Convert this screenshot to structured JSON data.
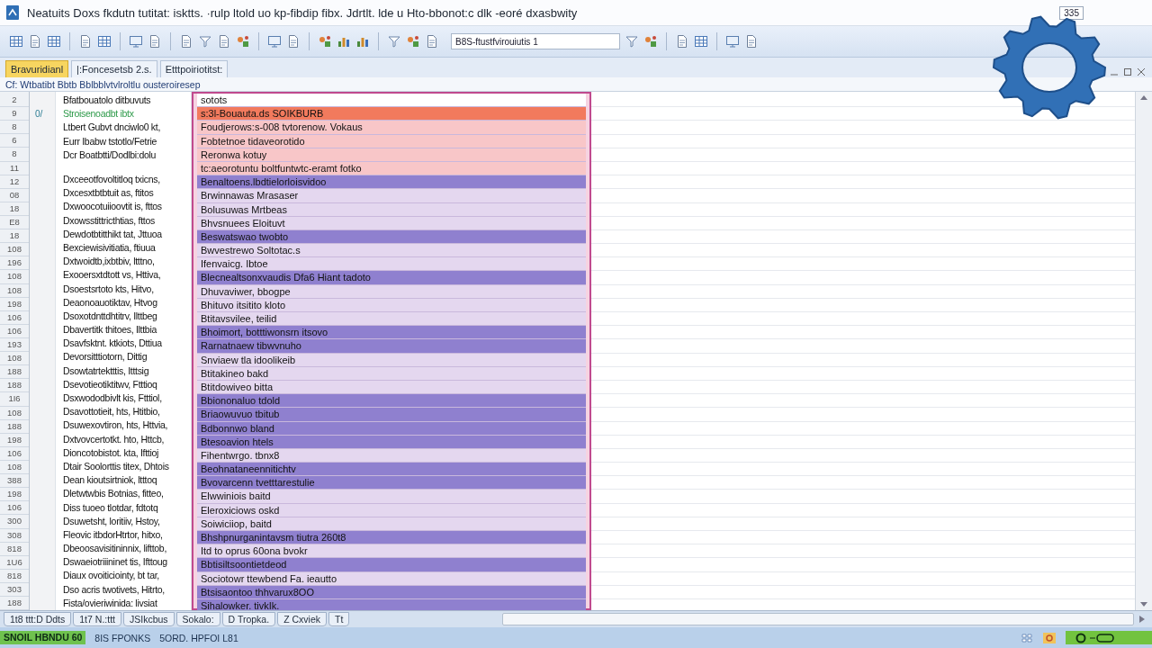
{
  "window": {
    "title": "Neatuits Doxs fkdutn tutitat: isktts. ·rulp ltold uo kp-fibdip fibx. Jdrtlt. lde u Hto-bbonot:c dlk -eoré dxasbwity",
    "badge": "335"
  },
  "toolbar": {
    "field_value": "B8S-ftustfvirouiutis 1"
  },
  "tabs": [
    {
      "label": "Bravuridianl",
      "selected": true
    },
    {
      "label": "|:Foncesetsb 2.s.",
      "selected": false
    },
    {
      "label": "Etttpoiriotitst:",
      "selected": false
    }
  ],
  "formula_bar": {
    "text": "Cf: Wtbatibt Bbtb Bblbblvtvlroltlu ousteroiresep"
  },
  "rows": [
    {
      "number": "2",
      "left": "Bfatbouatolo ditbuvuts",
      "right": "sotots",
      "kind": "plain"
    },
    {
      "number": "9",
      "marker": "0/",
      "left": "Stroisenoadbt ibtx",
      "color": "#2e9a4a",
      "right": "s:3l-Bouauta.ds SOIKBURB",
      "kind": "accent"
    },
    {
      "number": "8",
      "left": "Ltbert Gubvt dnciwlo0 kt,",
      "right": "Foudjerows:s-008 tvtorenow. Vokaus",
      "kind": "pink"
    },
    {
      "number": "6",
      "left": "Eurr Ibabw tstotlo/Fetrie",
      "right": "Fobtetnoe tidaveorotido",
      "kind": "pink"
    },
    {
      "number": "8",
      "left": "Dcr Boatbtti/Dodlbi:dolu",
      "right": "Reronwa kotuy",
      "kind": "pink"
    },
    {
      "number": "11",
      "right": "tc:aeorotuntu boltfuntwtc-eramt fotko",
      "kind": "pink"
    },
    {
      "number": "12",
      "left": "Dxceeotfovoltitloq txicns,",
      "right": "Benaltoens.lbdtielorloisvidoo",
      "kind": "strong"
    },
    {
      "number": "08",
      "left": "Dxcesxtbtbtuit as, ftitos",
      "right": "Brwinnawas Mrasaser",
      "kind": "pale"
    },
    {
      "number": "18",
      "left": "Dxwoocotuiioovtit is, fttos",
      "right": "Bolusuwas Mrtbeas",
      "kind": "pale"
    },
    {
      "number": "E8",
      "left": "Dxowsstittricthtias, fttos",
      "right": "Bhvsnuees Eloituvt",
      "kind": "pale"
    },
    {
      "number": "18",
      "left": "Dewdotbtitthikt tat, Jttuoa",
      "right": "Beswatswao twobto",
      "kind": "strong"
    },
    {
      "number": "108",
      "left": "Bexciewisivitiatia, ftiuua",
      "right": "Bwvestrewo Soltotac.s",
      "kind": "pale"
    },
    {
      "number": "196",
      "left": "Dxtwoidtb,ixbtbiv, ltttno,",
      "right": "Ifenvaicg. Ibtoe",
      "kind": "pale"
    },
    {
      "number": "108",
      "left": "Exooersxtdtott vs, Httiva,",
      "right": "Blecnealtsonxvaudis Dfa6 Hiant tadoto",
      "kind": "strong"
    },
    {
      "number": "108",
      "left": "Dsoestsrtoto kts, Hitvo,",
      "right": "Dhuvaviwer, bbogpe",
      "kind": "pale"
    },
    {
      "number": "198",
      "left": "Deaonoauotiktav, Htvog",
      "right": "Bhituvo itsitito kloto",
      "kind": "pale"
    },
    {
      "number": "106",
      "left": "Dsoxotdnttdhtitrv, Ilttbeg",
      "right": "Btitavsvilee, teilid",
      "kind": "pale"
    },
    {
      "number": "106",
      "left": "Dbavertitk thitoes, Ilttbia",
      "right": "Bhoimort, botttiwonsrn itsovo",
      "kind": "strong"
    },
    {
      "number": "193",
      "left": "Dsavfsktnt. ktkiots, Dttiua",
      "right": "Rarnatnaew tibwvnuho",
      "kind": "strong"
    },
    {
      "number": "108",
      "left": "Devorsitttiotorn, Dittig",
      "right": "Snviaew tla idoolikeib",
      "kind": "pale"
    },
    {
      "number": "188",
      "left": "Dsowtatrtektttis, Itttsig",
      "right": "Btitakineo bakd",
      "kind": "pale"
    },
    {
      "number": "188",
      "left": "Dsevotieotiktitwv, Ftttioq",
      "right": "Btitdowiveo bitta",
      "kind": "pale"
    },
    {
      "number": "1I6",
      "left": "Dsxwododbivlt kis, Ftttiol,",
      "right": "Bbiononaluo tdold",
      "kind": "strong"
    },
    {
      "number": "108",
      "left": "Dsavottotieit, hts, Htitbio,",
      "right": "Briaowuvuo tbitub",
      "kind": "strong"
    },
    {
      "number": "188",
      "left": "Dsuwexovtiron, hts, Httvia,",
      "right": "Bdbonnwo bland",
      "kind": "strong"
    },
    {
      "number": "198",
      "left": "Dxtvovcertotkt. hto, Httcb,",
      "right": "Btesoavion htels",
      "kind": "strong"
    },
    {
      "number": "106",
      "left": "Dioncotobistot. kta, Ifttioj",
      "right": "Fihentwrgo. tbnx8",
      "kind": "pale"
    },
    {
      "number": "108",
      "left": "Dtair Soolorttis titex, Dhtois",
      "right": "Beohnataneennitichtv",
      "kind": "strong"
    },
    {
      "number": "388",
      "left": "Dean kioutsirtniok, ltttoq",
      "right": "Bvovarcenn tvetttarestulie",
      "kind": "strong"
    },
    {
      "number": "198",
      "left": "Dletwtwbis Botnias, fitteo,",
      "right": "Elwwiniois baitd",
      "kind": "pale"
    },
    {
      "number": "106",
      "left": "Diss tuoeo tlotdar, fdtotq",
      "right": "Eleroxiciows oskd",
      "kind": "pale"
    },
    {
      "number": "300",
      "left": "Dsuwetsht, loritiiv, Hstoy,",
      "right": "Soiwiciiop, baitd",
      "kind": "pale"
    },
    {
      "number": "308",
      "left": "Fleovic itbdorHtrtor, hitxo,",
      "right": "Bhshpnurganintavsm tiutra 260t8",
      "kind": "strong"
    },
    {
      "number": "818",
      "left": "Dbeoosavisitininnix, lifttob,",
      "right": "Itd to oprus 60ona bvokr",
      "kind": "pale"
    },
    {
      "number": "1U6",
      "left": "Dswaeiotriiininet tis, Ifttoug",
      "right": "Bbtisiltsoontietdeod",
      "kind": "strong"
    },
    {
      "number": "818",
      "left": "Diaux ovoiticiointy, bt tar,",
      "right": "Sociotowr ttewbend Fa. ieautto",
      "kind": "pale"
    },
    {
      "number": "303",
      "left": "Dso acris twotivets, Hitrto,",
      "right": "Btsisaontoo thhvarux8OO",
      "kind": "strong"
    },
    {
      "number": "188",
      "left": "Fista/ovieriwinida: livsiat",
      "right": "Sihalowker. tivkIk.",
      "kind": "strong"
    }
  ],
  "sheet_tabs": [
    "1t8 ttt:D Ddts",
    "1t7 N.:ttt",
    "JSIkcbus",
    "Sokalo:",
    "D Tropka.",
    "Z Cxviek",
    "Tt"
  ],
  "status_bar": {
    "mode": "SNOIL HBNDU 60",
    "items": [
      "8IS FPONKS",
      "5ORD. HPFOI L81"
    ]
  }
}
